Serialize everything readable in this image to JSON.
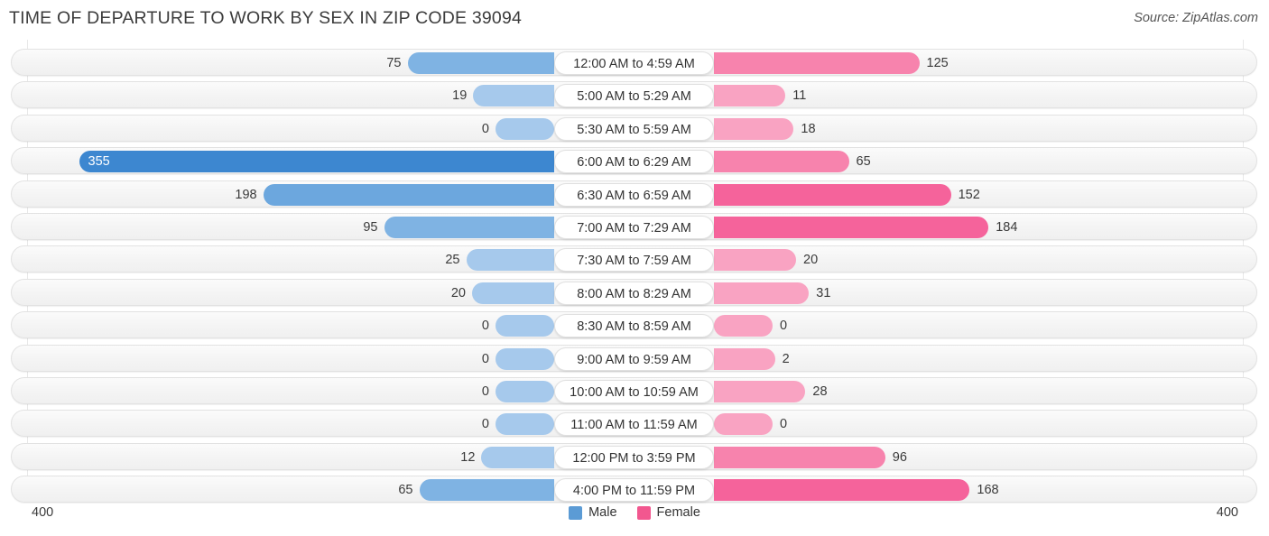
{
  "header": {
    "title": "TIME OF DEPARTURE TO WORK BY SEX IN ZIP CODE 39094",
    "source": "Source: ZipAtlas.com"
  },
  "legend": {
    "male_label": "Male",
    "female_label": "Female",
    "male_color": "#5b9bd5",
    "female_color": "#f2578f"
  },
  "axis": {
    "left_label": "400",
    "right_label": "400",
    "max": 400
  },
  "chart_data": {
    "type": "bar",
    "subtype": "diverging-bidirectional",
    "title": "TIME OF DEPARTURE TO WORK BY SEX IN ZIP CODE 39094",
    "xlabel": "",
    "ylabel": "",
    "xlim": [
      400,
      400
    ],
    "grid": true,
    "legend_position": "bottom-center",
    "categories": [
      "12:00 AM to 4:59 AM",
      "5:00 AM to 5:29 AM",
      "5:30 AM to 5:59 AM",
      "6:00 AM to 6:29 AM",
      "6:30 AM to 6:59 AM",
      "7:00 AM to 7:29 AM",
      "7:30 AM to 7:59 AM",
      "8:00 AM to 8:29 AM",
      "8:30 AM to 8:59 AM",
      "9:00 AM to 9:59 AM",
      "10:00 AM to 10:59 AM",
      "11:00 AM to 11:59 AM",
      "12:00 PM to 3:59 PM",
      "4:00 PM to 11:59 PM"
    ],
    "series": [
      {
        "name": "Male",
        "color": "#5b9bd5",
        "direction": "left",
        "values": [
          75,
          19,
          0,
          355,
          198,
          95,
          25,
          20,
          0,
          0,
          0,
          0,
          12,
          65
        ]
      },
      {
        "name": "Female",
        "color": "#f2578f",
        "direction": "right",
        "values": [
          125,
          11,
          18,
          65,
          152,
          184,
          20,
          31,
          0,
          2,
          28,
          0,
          96,
          168
        ]
      }
    ]
  },
  "rows": [
    {
      "label": "12:00 AM to 4:59 AM",
      "male": 75,
      "female": 125
    },
    {
      "label": "5:00 AM to 5:29 AM",
      "male": 19,
      "female": 11
    },
    {
      "label": "5:30 AM to 5:59 AM",
      "male": 0,
      "female": 18
    },
    {
      "label": "6:00 AM to 6:29 AM",
      "male": 355,
      "female": 65
    },
    {
      "label": "6:30 AM to 6:59 AM",
      "male": 198,
      "female": 152
    },
    {
      "label": "7:00 AM to 7:29 AM",
      "male": 95,
      "female": 184
    },
    {
      "label": "7:30 AM to 7:59 AM",
      "male": 25,
      "female": 20
    },
    {
      "label": "8:00 AM to 8:29 AM",
      "male": 20,
      "female": 31
    },
    {
      "label": "8:30 AM to 8:59 AM",
      "male": 0,
      "female": 0
    },
    {
      "label": "9:00 AM to 9:59 AM",
      "male": 0,
      "female": 2
    },
    {
      "label": "10:00 AM to 10:59 AM",
      "male": 0,
      "female": 28
    },
    {
      "label": "11:00 AM to 11:59 AM",
      "male": 0,
      "female": 0
    },
    {
      "label": "12:00 PM to 3:59 PM",
      "male": 12,
      "female": 96
    },
    {
      "label": "4:00 PM to 11:59 PM",
      "male": 65,
      "female": 168
    }
  ]
}
